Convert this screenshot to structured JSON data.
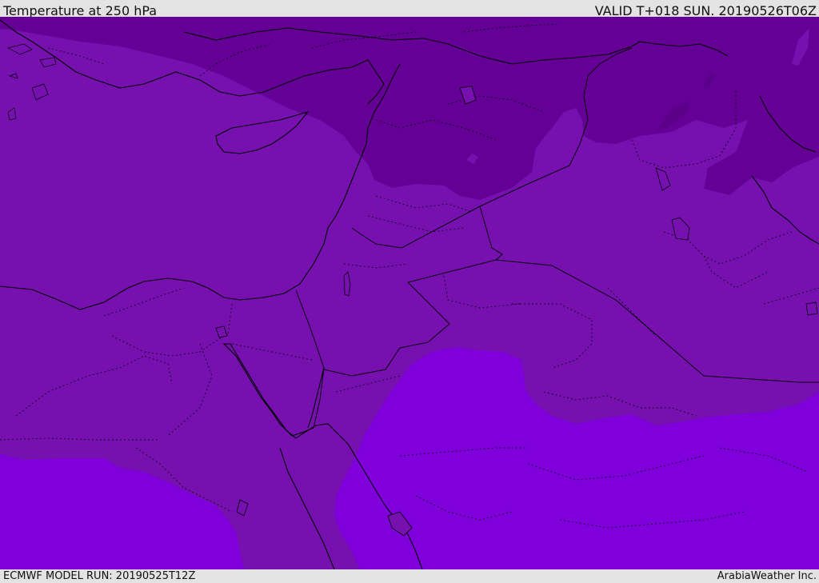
{
  "header": {
    "title": "Temperature at 250 hPa",
    "valid": "VALID T+018 SUN. 20190526T06Z"
  },
  "footer": {
    "model_run": "ECMWF MODEL RUN: 20190525T12Z",
    "credit": "ArabiaWeather Inc."
  },
  "colors": {
    "background_band": "#e3e3e3",
    "cold_band": "#650097",
    "mid_band": "#7611b0",
    "warm_band": "#7f00db",
    "border": "#000000"
  }
}
